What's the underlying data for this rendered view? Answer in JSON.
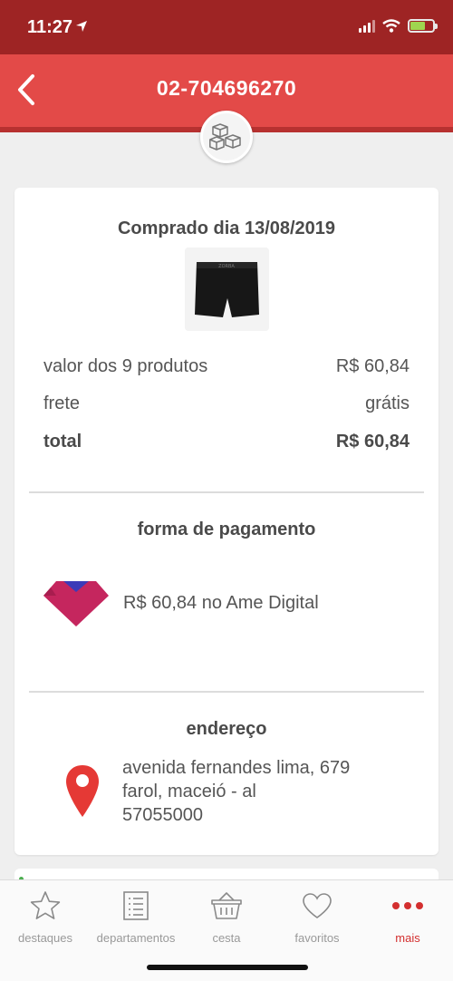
{
  "status": {
    "time": "11:27",
    "icons": [
      "location-arrow-icon",
      "signal-icon",
      "wifi-icon",
      "battery-charging-icon"
    ]
  },
  "header": {
    "title": "02-704696270",
    "back_icon": "chevron-left-icon",
    "badge_icon": "boxes-icon"
  },
  "order": {
    "purchased": "Comprado dia 13/08/2019",
    "rows": [
      {
        "label": "valor dos 9 produtos",
        "value": "R$ 60,84"
      },
      {
        "label": "frete",
        "value": "grátis"
      },
      {
        "label": "total",
        "value": "R$ 60,84"
      }
    ]
  },
  "payment": {
    "heading": "forma de pagamento",
    "text": "R$ 60,84 no Ame Digital",
    "icon": "ame-logo-icon"
  },
  "address": {
    "heading": "endereço",
    "line1": "avenida fernandes lima, 679",
    "line2": "farol, maceió - al",
    "line3": "57055000"
  },
  "tabs": [
    {
      "label": "destaques",
      "icon": "star-icon"
    },
    {
      "label": "departamentos",
      "icon": "list-icon"
    },
    {
      "label": "cesta",
      "icon": "basket-icon"
    },
    {
      "label": "favoritos",
      "icon": "heart-icon"
    },
    {
      "label": "mais",
      "icon": "more-dots-icon",
      "active": true
    }
  ],
  "colors": {
    "status_bar": "#9e2424",
    "header": "#e34a48",
    "accent": "#d32f2f",
    "pin": "#e53935"
  }
}
